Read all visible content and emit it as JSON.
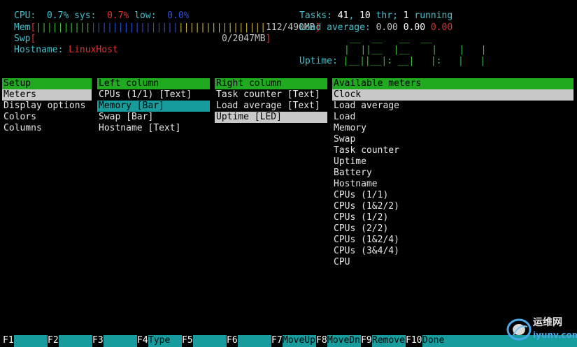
{
  "header": {
    "cpu": {
      "label": "CPU:",
      "value": "0.7%",
      "sys_label": "sys:",
      "sys_value": "0.7%",
      "low_label": "low:",
      "low_value": "0.0%"
    },
    "mem": {
      "label": "Mem",
      "open": "[",
      "bar_green": "||||||||||",
      "bar_blue": "||||||||||||||||",
      "bar_yellow": "||||||||||||||||",
      "value": "112/490MB",
      "close": "]"
    },
    "swp": {
      "label": "Swp",
      "open": "[",
      "value": "0/2047MB",
      "close": "]"
    },
    "hostname": {
      "label": "Hostname:",
      "value": "LinuxHost"
    },
    "tasks": {
      "label": "Tasks:",
      "count": "41",
      "sep": ",",
      "thr": "10",
      "thr_label": "thr;",
      "running": "1",
      "running_label": "running"
    },
    "load": {
      "label": "Load average:",
      "v1": "0.00",
      "v2": "0.00",
      "v3": "0.00"
    },
    "uptime": {
      "label": "Uptime:",
      "led_line1": "__  __   __  __",
      "led_line2": "|  ||__  |__    |    |   |",
      "led_line3": "|__||__|: __|   |:   |   |"
    }
  },
  "setup": {
    "header": "Setup",
    "items": [
      "Meters",
      "Display options",
      "Colors",
      "Columns"
    ]
  },
  "left_column": {
    "header": "Left column",
    "items": [
      "CPUs (1/1) [Text]",
      "Memory [Bar]",
      "Swap [Bar]",
      "Hostname [Text]"
    ]
  },
  "right_column": {
    "header": "Right column",
    "items": [
      "Task counter [Text]",
      "Load average [Text]",
      "Uptime [LED]"
    ]
  },
  "available": {
    "header": "Available meters",
    "items": [
      "Clock",
      "Load average",
      "Load",
      "Memory",
      "Swap",
      "Task counter",
      "Uptime",
      "Battery",
      "Hostname",
      "CPUs (1/1)",
      "CPUs (1&2/2)",
      "CPUs (1/2)",
      "CPUs (2/2)",
      "CPUs (1&2/4)",
      "CPUs (3&4/4)",
      "CPU"
    ]
  },
  "fkeys": [
    {
      "key": "F1",
      "label": ""
    },
    {
      "key": "F2",
      "label": ""
    },
    {
      "key": "F3",
      "label": ""
    },
    {
      "key": "F4",
      "label": "Type"
    },
    {
      "key": "F5",
      "label": ""
    },
    {
      "key": "F6",
      "label": ""
    },
    {
      "key": "F7",
      "label": "MoveUp"
    },
    {
      "key": "F8",
      "label": "MoveDn"
    },
    {
      "key": "F9",
      "label": "Remove"
    },
    {
      "key": "F10",
      "label": "Done"
    }
  ],
  "watermark": {
    "cn": "运维网",
    "en": "iyunv.com"
  },
  "colors": {
    "cyan": "#3ec1cd",
    "green": "#1faa1f",
    "red": "#e03030",
    "selected_cyan": "#169c9c",
    "selected_gray": "#c8c8c8"
  }
}
